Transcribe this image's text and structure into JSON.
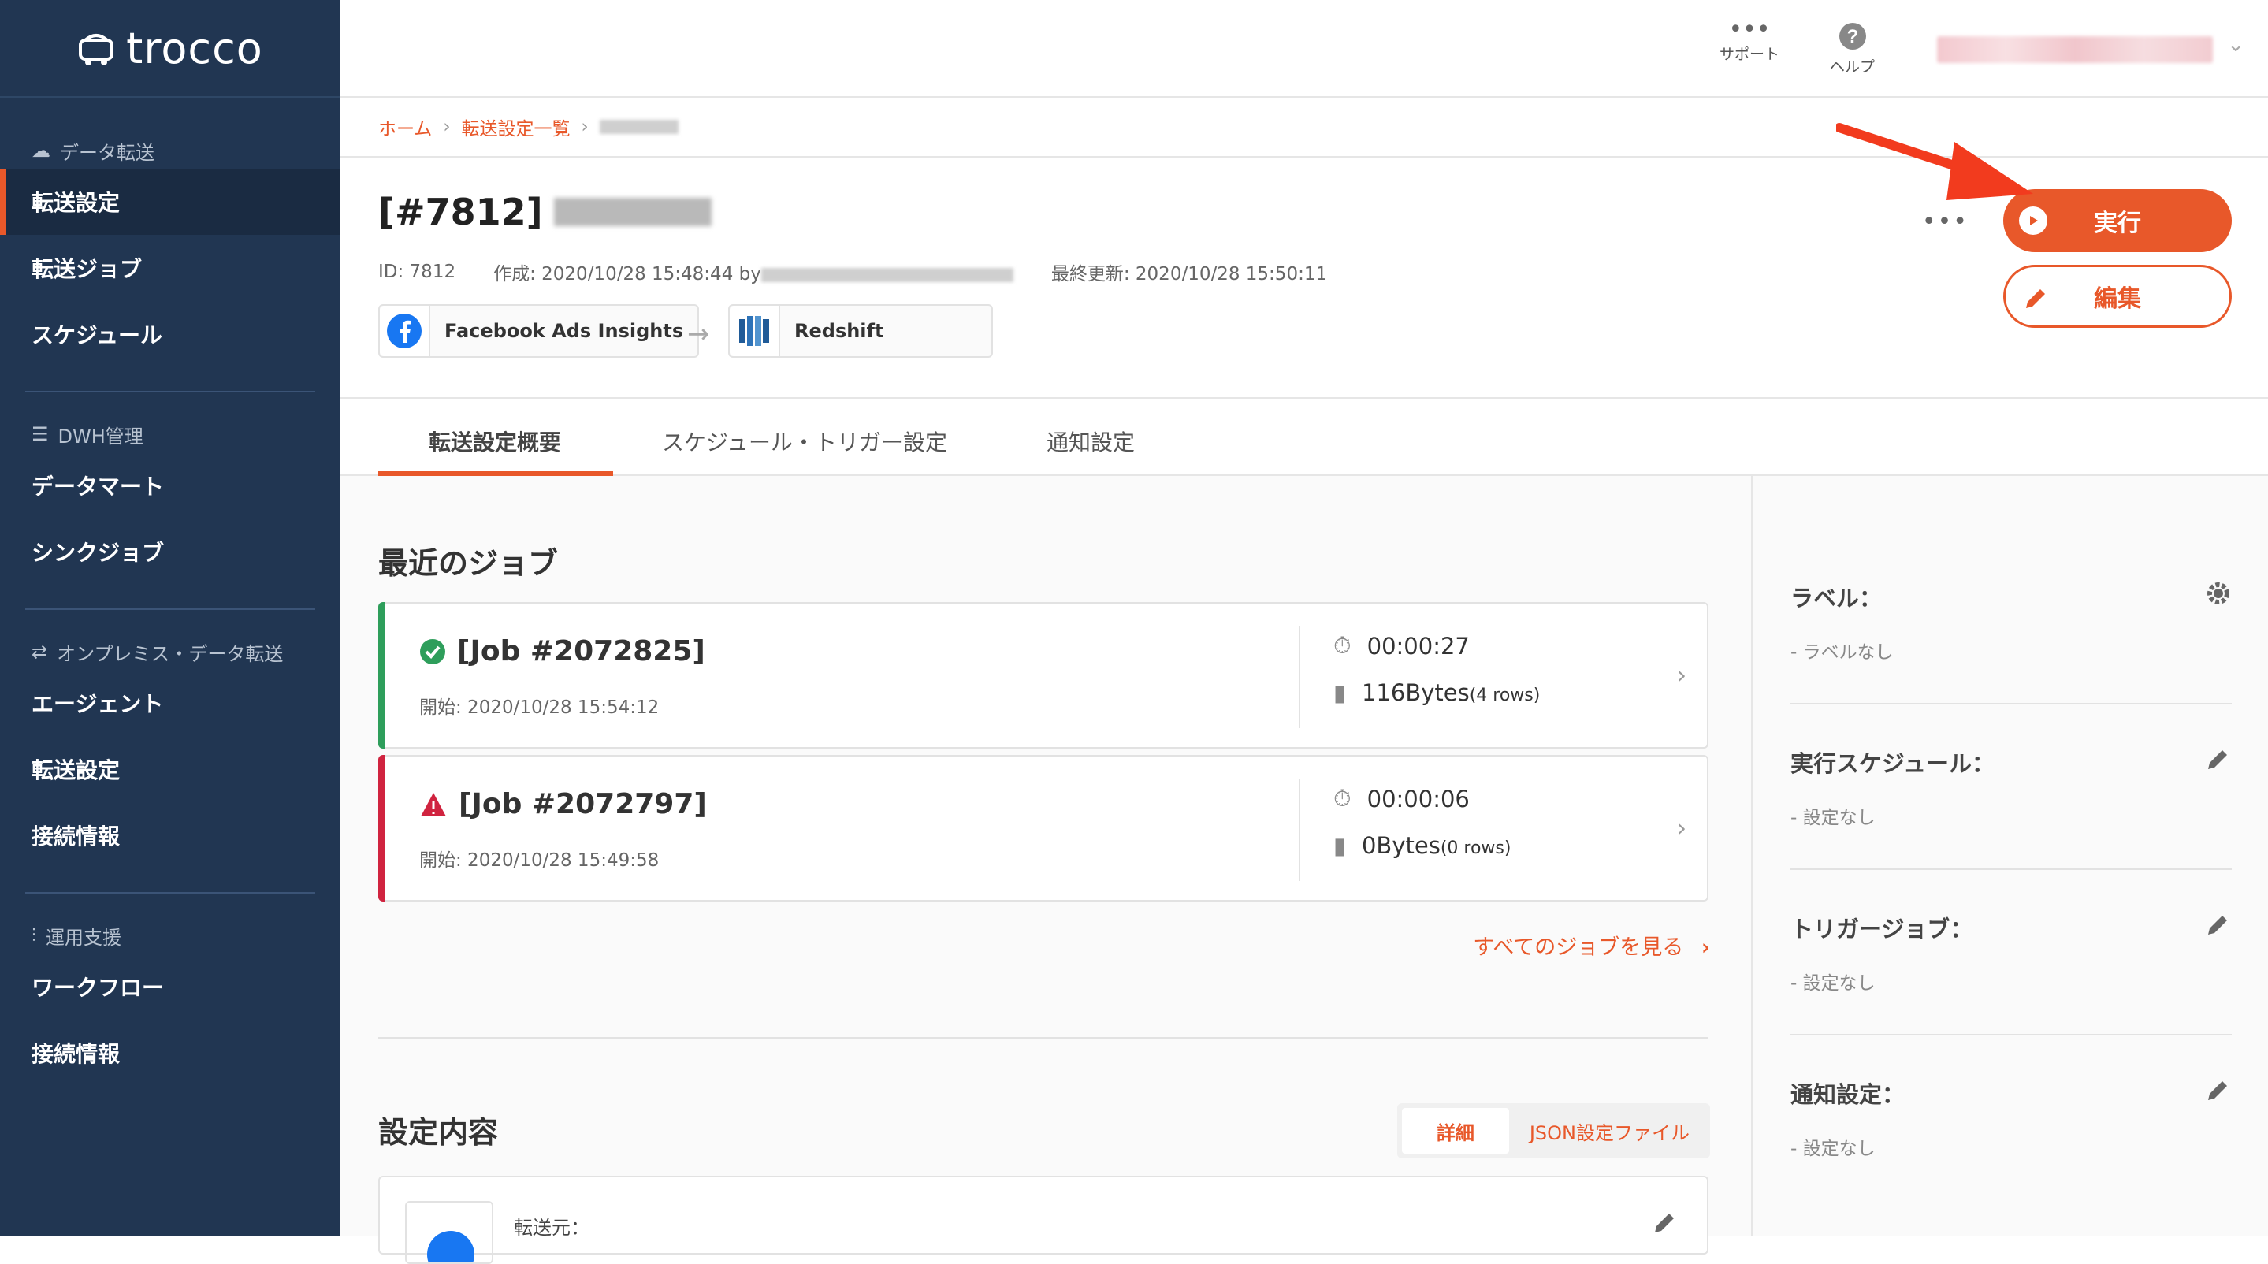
{
  "app": {
    "name": "trocco"
  },
  "sidebar": {
    "sections": [
      {
        "head": "データ転送",
        "icon": "cloud-upload-icon",
        "items": [
          {
            "label": "転送設定",
            "active": true
          },
          {
            "label": "転送ジョブ"
          },
          {
            "label": "スケジュール"
          }
        ]
      },
      {
        "head": "DWH管理",
        "icon": "list-icon",
        "items": [
          {
            "label": "データマート"
          },
          {
            "label": "シンクジョブ"
          }
        ]
      },
      {
        "head": "オンプレミス・データ転送",
        "icon": "transfer-icon",
        "items": [
          {
            "label": "エージェント"
          },
          {
            "label": "転送設定"
          },
          {
            "label": "接続情報"
          }
        ]
      },
      {
        "head": "運用支援",
        "icon": "sliders-icon",
        "items": [
          {
            "label": "ワークフロー"
          },
          {
            "label": "接続情報"
          }
        ]
      }
    ]
  },
  "topbar": {
    "support_label": "サポート",
    "help_label": "ヘルプ"
  },
  "breadcrumb": {
    "home": "ホーム",
    "list": "転送設定一覧"
  },
  "header": {
    "title": "[#7812]",
    "id_text": "ID: 7812",
    "created_text": "作成: 2020/10/28 15:48:44 by",
    "updated_text": "最終更新: 2020/10/28 15:50:11",
    "source_label": "Facebook Ads Insights",
    "dest_label": "Redshift",
    "run_label": "実行",
    "edit_label": "編集"
  },
  "tabs": [
    {
      "label": "転送設定概要",
      "active": true
    },
    {
      "label": "スケジュール・トリガー設定"
    },
    {
      "label": "通知設定"
    }
  ],
  "main": {
    "recent_jobs_title": "最近のジョブ",
    "jobs": [
      {
        "title": "[Job #2072825]",
        "status": "success",
        "start": "開始: 2020/10/28 15:54:12",
        "duration": "00:00:27",
        "size": "116Bytes",
        "rows": "(4 rows)"
      },
      {
        "title": "[Job #2072797]",
        "status": "error",
        "start": "開始: 2020/10/28 15:49:58",
        "duration": "00:00:06",
        "size": "0Bytes",
        "rows": "(0 rows)"
      }
    ],
    "all_jobs_link": "すべてのジョブを見る",
    "settings_title": "設定内容",
    "seg_detail": "詳細",
    "seg_json": "JSON設定ファイル",
    "source_caption": "転送元："
  },
  "right_panel": {
    "label_title": "ラベル：",
    "label_value": "- ラベルなし",
    "schedule_title": "実行スケジュール：",
    "schedule_value": "- 設定なし",
    "trigger_title": "トリガージョブ：",
    "trigger_value": "- 設定なし",
    "notify_title": "通知設定：",
    "notify_value": "- 設定なし"
  },
  "colors": {
    "accent": "#e8582a",
    "sidebar": "#213652",
    "success": "#2e9e5b",
    "error": "#d0233f"
  }
}
